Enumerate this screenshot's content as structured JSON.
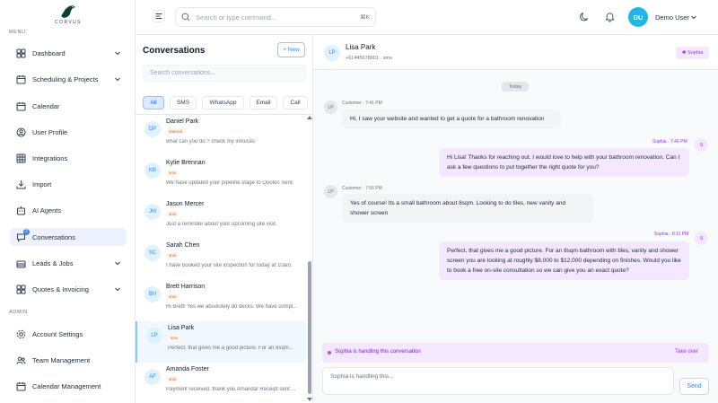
{
  "brand": {
    "name": "CORVUS"
  },
  "sidebar": {
    "menu_label": "MENU",
    "admin_label": "ADMIN",
    "items": [
      {
        "label": "Dashboard",
        "icon": "grid-icon",
        "has_chevron": true
      },
      {
        "label": "Scheduling & Projects",
        "icon": "calendar-range-icon",
        "has_chevron": true
      },
      {
        "label": "Calendar",
        "icon": "calendar-icon",
        "has_chevron": false
      },
      {
        "label": "User Profile",
        "icon": "user-circle-icon",
        "has_chevron": false
      },
      {
        "label": "Integrations",
        "icon": "integrations-grid-icon",
        "has_chevron": false
      },
      {
        "label": "Import",
        "icon": "download-icon",
        "has_chevron": false
      },
      {
        "label": "AI Agents",
        "icon": "bot-icon",
        "has_chevron": false
      },
      {
        "label": "Conversations",
        "icon": "chat-icon",
        "has_chevron": false,
        "active": true,
        "badge": "2"
      },
      {
        "label": "Leads & Jobs",
        "icon": "briefcase-icon",
        "has_chevron": true
      },
      {
        "label": "Quotes & Invoicing",
        "icon": "grid-icon",
        "has_chevron": true
      }
    ],
    "admin_items": [
      {
        "label": "Account Settings",
        "icon": "gear-icon"
      },
      {
        "label": "Team Management",
        "icon": "team-icon"
      },
      {
        "label": "Calendar Management",
        "icon": "calendar-icon"
      }
    ]
  },
  "topbar": {
    "search_placeholder": "Search or type command...",
    "shortcut": "⌘K",
    "user_initials": "DU",
    "user_name": "Demo User"
  },
  "conversations": {
    "title": "Conversations",
    "new_label": "+ New",
    "search_placeholder": "Search conversations...",
    "filters": [
      "All",
      "SMS",
      "WhatsApp",
      "Email",
      "Call"
    ],
    "items": [
      {
        "initials": "DP",
        "name": "Daniel Park",
        "tag": "internal",
        "message": "what can you do ? check my invoices"
      },
      {
        "initials": "KB",
        "name": "Kylie Brennan",
        "tag": "sms",
        "message": "We have updated your pipeline stage to Quotes Sent."
      },
      {
        "initials": "JM",
        "name": "Jason Mercer",
        "tag": "sms",
        "message": "Just a reminder about your upcoming site visit."
      },
      {
        "initials": "SC",
        "name": "Sarah Chen",
        "tag": "sms",
        "message": "I have booked your site inspection for today at 10am."
      },
      {
        "initials": "BH",
        "name": "Brett Harrison",
        "tag": "sms",
        "message": "Hi Brett! Yes we absolutely do decks. We have compl..."
      },
      {
        "initials": "LP",
        "name": "Lisa Park",
        "tag": "sms",
        "message": "Perfect, that gives me a good picture. For an 8sqm...",
        "selected": true
      },
      {
        "initials": "AF",
        "name": "Amanda Foster",
        "tag": "sms",
        "message": "Payment received, thank you Amanda! Receipt sent ..."
      }
    ]
  },
  "chat": {
    "contact_initials": "LP",
    "contact_name": "Lisa Park",
    "contact_sub": "+61445678901 · sms",
    "agent_pill": "✱ Sophia",
    "date_divider": "Today",
    "messages": [
      {
        "dir": "in",
        "avatar": "LP",
        "meta": "Customer · 7:41 PM",
        "text": "Hi, I saw your website and wanted to get a quote for a bathroom renovation"
      },
      {
        "dir": "out",
        "avatar": "S",
        "meta": "Sophia · 7:46 PM",
        "text": "Hi Lisa! Thanks for reaching out. I would love to help with your bathroom renovation. Can I ask a few questions to put together the right quote for you?"
      },
      {
        "dir": "in",
        "avatar": "LP",
        "meta": "Customer · 7:56 PM",
        "text": "Yes of course! Its a small bathroom about 8sqm. Looking to do tiles, new vanity and shower screen"
      },
      {
        "dir": "out",
        "avatar": "S",
        "meta": "Sophia · 8:11 PM",
        "text": "Perfect, that gives me a good picture. For an 8sqm bathroom with tiles, vanity and shower screen you are looking at roughly $8,000 to $12,000 depending on finishes. Would you like to book a free on-site consultation so we can give you an exact quote?"
      }
    ],
    "handling_text": "Sophia is handling this conversation",
    "take_over_label": "Take over",
    "compose_placeholder": "Sophia is handling this...",
    "send_label": "Send"
  },
  "colors": {
    "accent": "#3b82f6",
    "agent": "#9333ea",
    "avatar": "#22b5e8"
  }
}
